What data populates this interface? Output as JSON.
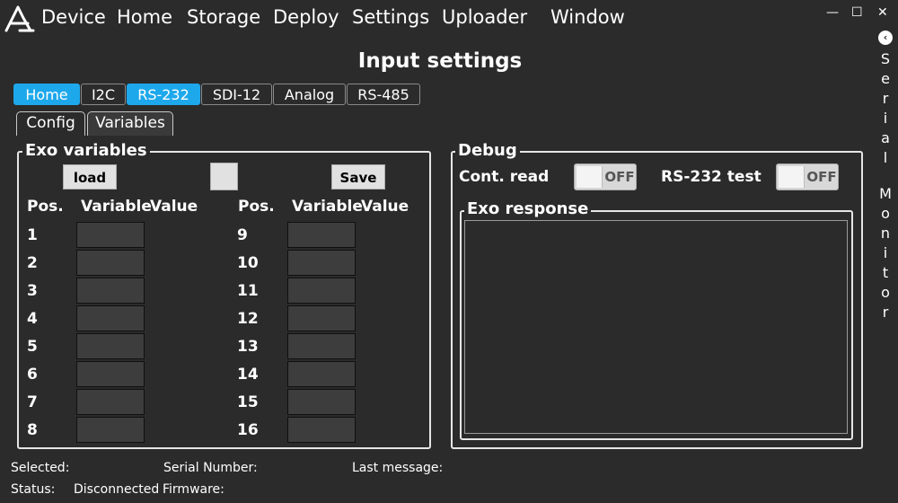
{
  "menu": {
    "items": [
      "Device",
      "Home",
      "Storage",
      "Deploy",
      "Settings",
      "Uploader",
      "Window"
    ]
  },
  "window_controls": {
    "minimize": "—",
    "maximize": "☐",
    "close": "✕"
  },
  "serial_monitor": {
    "letters": [
      "S",
      "e",
      "r",
      "i",
      "a",
      "l",
      " ",
      "M",
      "o",
      "n",
      "i",
      "t",
      "o",
      "r"
    ],
    "toggle_icon": "‹"
  },
  "page": {
    "title": "Input settings"
  },
  "tabs": [
    {
      "label": "Home",
      "active": true
    },
    {
      "label": "I2C",
      "active": false
    },
    {
      "label": "RS-232",
      "active": true
    },
    {
      "label": "SDI-12",
      "active": false
    },
    {
      "label": "Analog",
      "active": false
    },
    {
      "label": "RS-485",
      "active": false
    }
  ],
  "subtabs": [
    {
      "label": "Config",
      "active": false
    },
    {
      "label": "Variables",
      "active": true
    }
  ],
  "exo": {
    "title": "Exo variables",
    "load_label": "load",
    "save_label": "Save",
    "col_pos": "Pos.",
    "col_variable": "Variable",
    "col_value": "Value",
    "left_positions": [
      "1",
      "2",
      "3",
      "4",
      "5",
      "6",
      "7",
      "8"
    ],
    "right_positions": [
      "9",
      "10",
      "11",
      "12",
      "13",
      "14",
      "15",
      "16"
    ]
  },
  "debug": {
    "title": "Debug",
    "cont_read_label": "Cont. read",
    "cont_read_state": "OFF",
    "rs232_test_label": "RS-232 test",
    "rs232_test_state": "OFF",
    "response_title": "Exo response",
    "response_text": ""
  },
  "status_bar": {
    "selected_label": "Selected:",
    "serial_label": "Serial Number:",
    "last_message_label": "Last message:",
    "status_label": "Status:",
    "status_value": "Disconnected",
    "firmware_label": "Firmware:"
  },
  "colors": {
    "background": "#2b2b2b",
    "accent": "#1ea8ec",
    "input_bg": "#3d3d3d"
  }
}
